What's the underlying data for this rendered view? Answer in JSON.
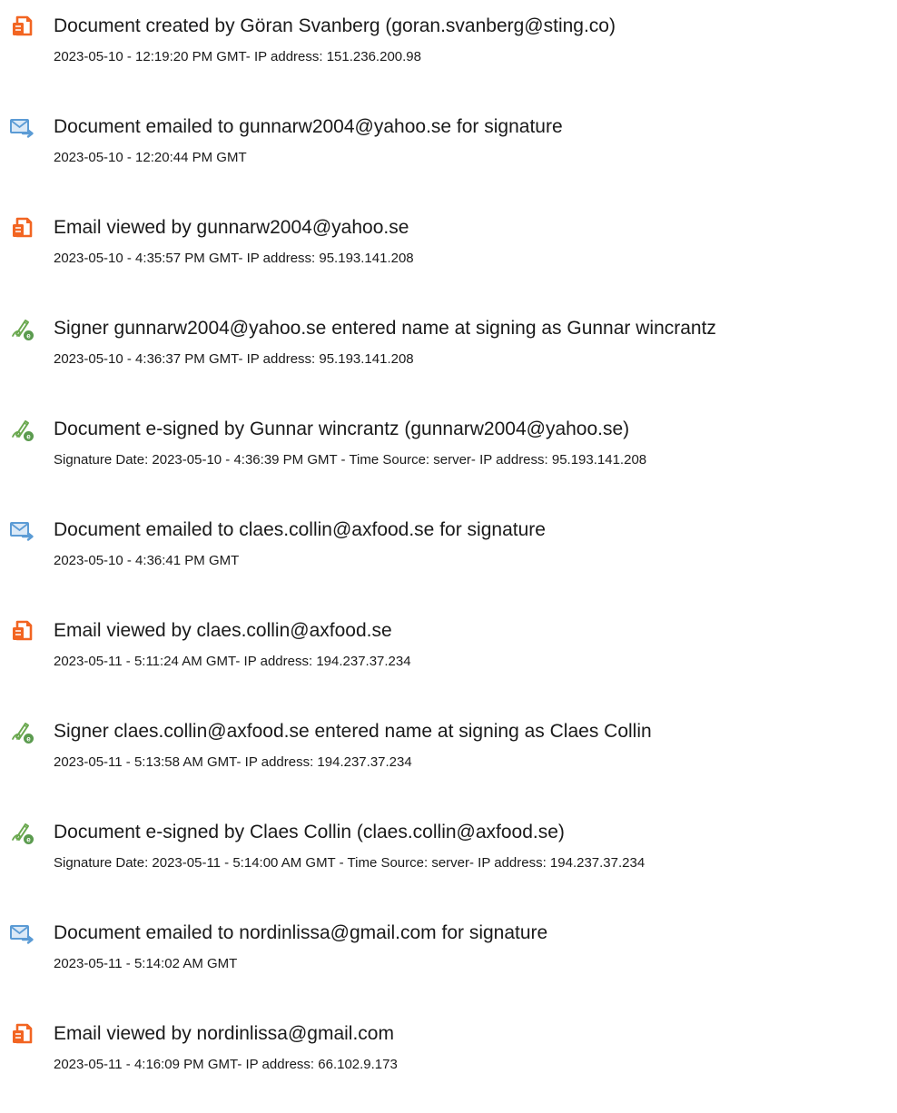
{
  "events": [
    {
      "icon": "document-created-icon",
      "title": "Document created by Göran Svanberg (goran.svanberg@sting.co)",
      "detail": "2023-05-10 - 12:19:20 PM GMT- IP address: 151.236.200.98"
    },
    {
      "icon": "email-sent-icon",
      "title": "Document emailed to gunnarw2004@yahoo.se for signature",
      "detail": "2023-05-10 - 12:20:44 PM GMT"
    },
    {
      "icon": "document-viewed-icon",
      "title": "Email viewed by gunnarw2004@yahoo.se",
      "detail": "2023-05-10 - 4:35:57 PM GMT- IP address: 95.193.141.208"
    },
    {
      "icon": "esign-icon",
      "title": "Signer gunnarw2004@yahoo.se entered name at signing as Gunnar wincrantz",
      "detail": "2023-05-10 - 4:36:37 PM GMT- IP address: 95.193.141.208"
    },
    {
      "icon": "esign-icon",
      "title": "Document e-signed by Gunnar wincrantz (gunnarw2004@yahoo.se)",
      "detail": "Signature Date: 2023-05-10 - 4:36:39 PM GMT - Time Source: server- IP address: 95.193.141.208"
    },
    {
      "icon": "email-sent-icon",
      "title": "Document emailed to claes.collin@axfood.se for signature",
      "detail": "2023-05-10 - 4:36:41 PM GMT"
    },
    {
      "icon": "document-viewed-icon",
      "title": "Email viewed by claes.collin@axfood.se",
      "detail": "2023-05-11 - 5:11:24 AM GMT- IP address: 194.237.37.234"
    },
    {
      "icon": "esign-icon",
      "title": "Signer claes.collin@axfood.se entered name at signing as Claes Collin",
      "detail": "2023-05-11 - 5:13:58 AM GMT- IP address: 194.237.37.234"
    },
    {
      "icon": "esign-icon",
      "title": "Document e-signed by Claes Collin (claes.collin@axfood.se)",
      "detail": "Signature Date: 2023-05-11 - 5:14:00 AM GMT - Time Source: server- IP address: 194.237.37.234"
    },
    {
      "icon": "email-sent-icon",
      "title": "Document emailed to nordinlissa@gmail.com for signature",
      "detail": "2023-05-11 - 5:14:02 AM GMT"
    },
    {
      "icon": "document-viewed-icon",
      "title": "Email viewed by nordinlissa@gmail.com",
      "detail": "2023-05-11 - 4:16:09 PM GMT- IP address: 66.102.9.173"
    }
  ],
  "colors": {
    "document_icon": "#f26522",
    "email_icon": "#5b9bd5",
    "esign_pen": "#6aa84f",
    "text": "#1a1a1a"
  }
}
